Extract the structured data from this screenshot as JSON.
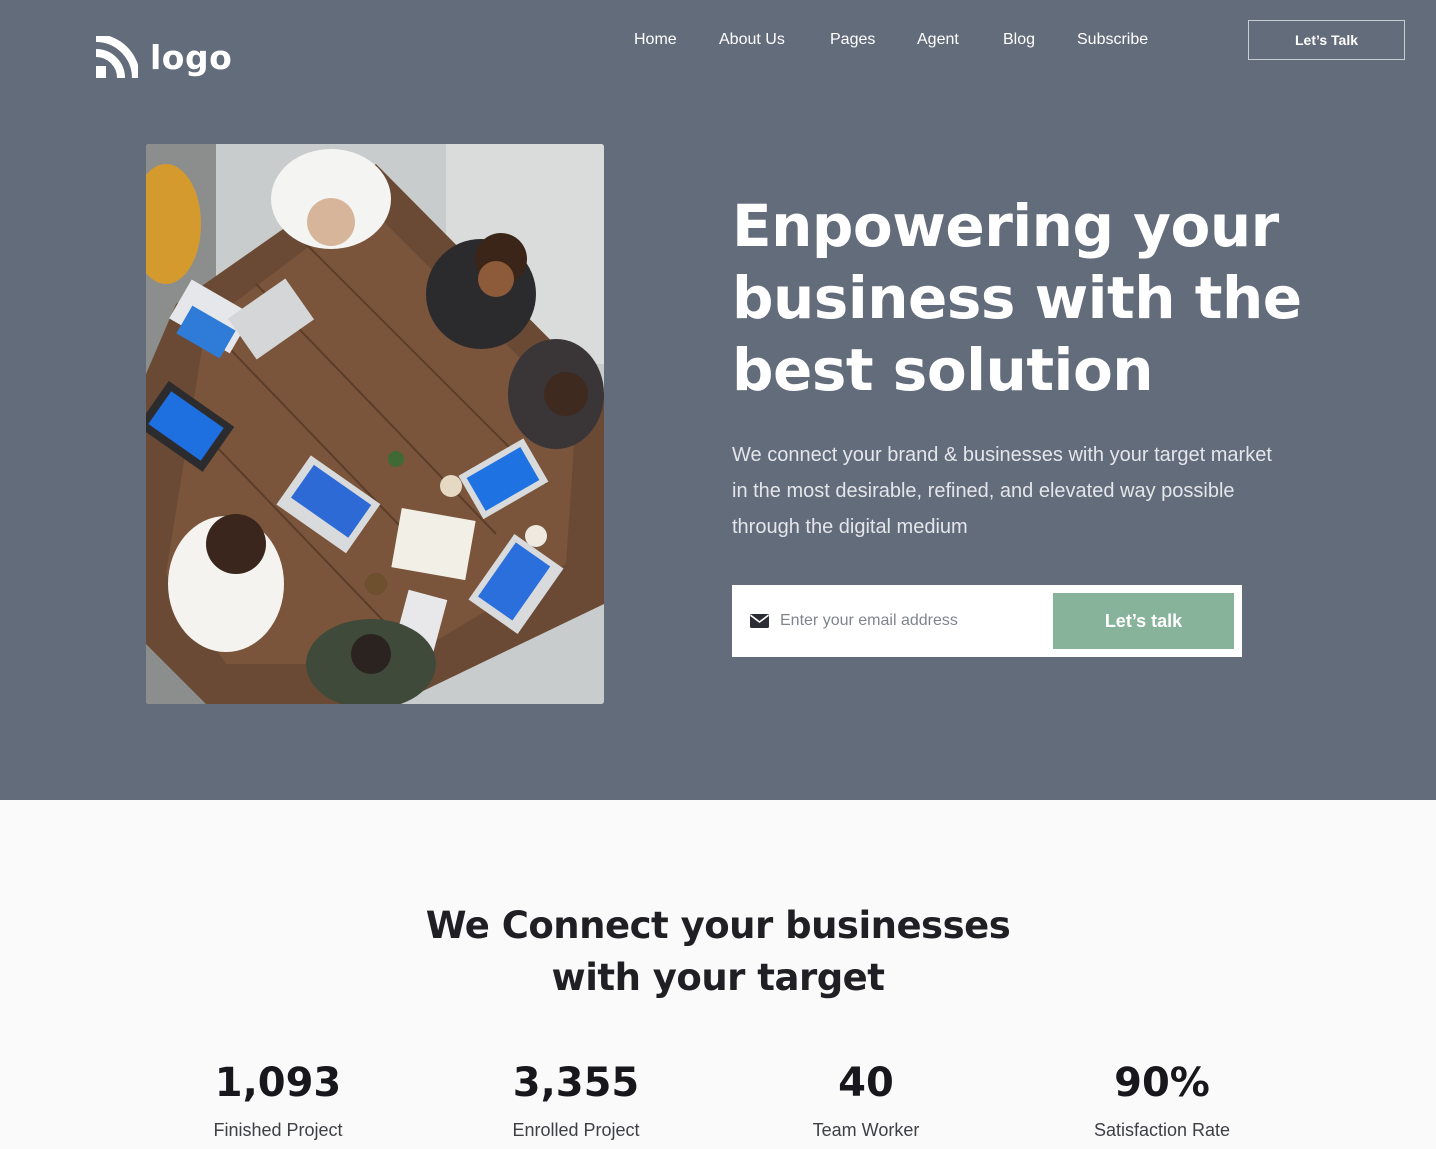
{
  "header": {
    "logo_text": "logo",
    "nav": [
      {
        "label": "Home"
      },
      {
        "label": "About Us"
      },
      {
        "label": "Pages"
      },
      {
        "label": "Agent"
      },
      {
        "label": "Blog"
      },
      {
        "label": "Subscribe"
      }
    ],
    "cta_label": "Let’s Talk"
  },
  "hero": {
    "headline_lines": [
      "Enpowering your",
      "business with the",
      "best solution"
    ],
    "subtext": "We connect your brand & businesses with your target market in the most desirable, refined, and elevated way possible through the digital medium",
    "email_placeholder": "Enter your email address",
    "email_value": "",
    "submit_label": "Let’s talk",
    "photo_icon": "meeting-photo"
  },
  "section": {
    "title_lines": [
      "We Connect your businesses",
      "with your target"
    ]
  },
  "stats": [
    {
      "value": "1,093",
      "label": "Finished Project"
    },
    {
      "value": "3,355",
      "label": "Enrolled Project"
    },
    {
      "value": "40",
      "label": "Team Worker"
    },
    {
      "value": "90%",
      "label": "Satisfaction Rate"
    }
  ],
  "colors": {
    "hero_bg": "#636c7a",
    "accent_green": "#88b39b",
    "page_bg": "#fafafa"
  }
}
